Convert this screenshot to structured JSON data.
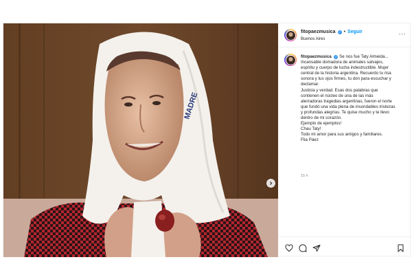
{
  "header": {
    "username": "fitopaezmusica",
    "separator": "•",
    "follow_label": "Seguir",
    "location": "Buenos Aires",
    "more_label": "···"
  },
  "caption": {
    "username": "fitopaezmusica",
    "lines": [
      "Se nos fue Taty Almeida...",
      "Incansable domadora de animales salvajes,",
      "espíritu y cuerpo de lucha indestructible. Mujer",
      "central de la historia argentina. Recuerdo tu risa",
      "sonora y tus ojos firmes, tu don para escuchar y",
      "declamar.",
      "Justicia y verdad. Esas dos palabras que",
      "contienen el núcleo de una de las más",
      "aterradoras tragedias argentinas, fueron el norte",
      "que fundó una vida plena de insondables tristezas",
      "y profundas alegrías. Te quise mucho y te llevo",
      "dentro de mi corazón.",
      "Ejemplo de ejemplos!",
      "Chau Taty!",
      "Todo mi amor para sus amigos y familiares.",
      "Flia Páez"
    ],
    "time": "15 h"
  },
  "media": {
    "headscarf_text": "MADRE",
    "icon": "photo-of-woman-with-white-headscarf"
  },
  "icons": {
    "next": "chevron-right-icon",
    "like": "heart-icon",
    "comment": "comment-icon",
    "share": "send-icon",
    "save": "bookmark-icon"
  },
  "colors": {
    "follow": "#0095f6",
    "verified": "#3897f0",
    "text": "#262626",
    "muted": "#8e8e8e"
  }
}
